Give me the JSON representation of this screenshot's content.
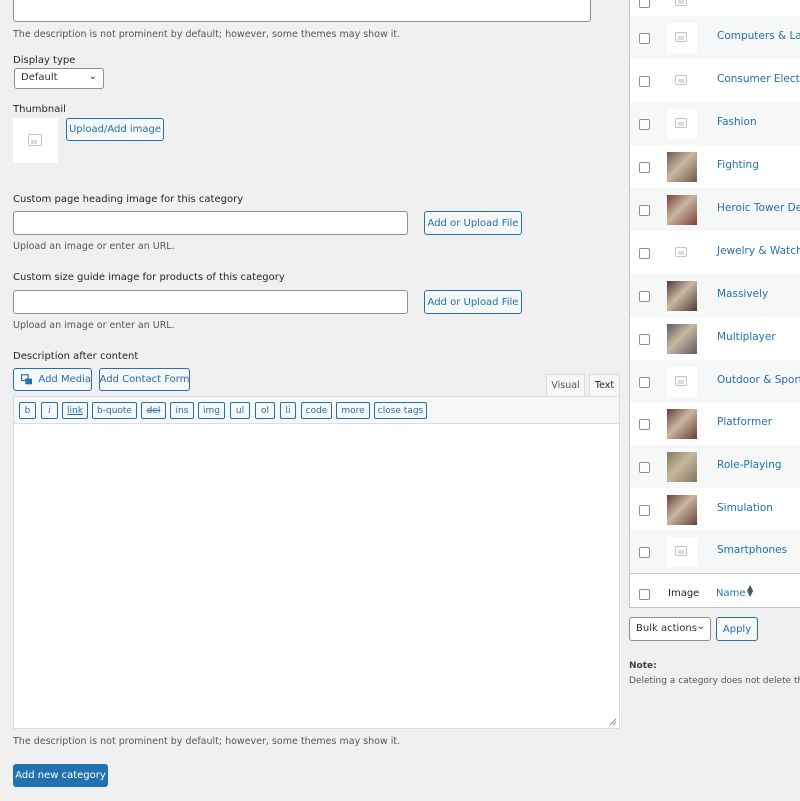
{
  "form": {
    "desc_help_top": "The description is not prominent by default; however, some themes may show it.",
    "display_type_label": "Display type",
    "display_type_value": "Default",
    "thumbnail_label": "Thumbnail",
    "upload_image_button": "Upload/Add image",
    "heading_image_label": "Custom page heading image for this category",
    "heading_image_value": "",
    "add_upload_file_button": "Add or Upload File",
    "upload_help": "Upload an image or enter an URL.",
    "size_guide_label": "Custom size guide image for products of this category",
    "size_guide_value": "",
    "desc_after_label": "Description after content",
    "add_media_button": "Add Media",
    "add_contact_form_button": "Add Contact Form",
    "tab_visual": "Visual",
    "tab_text": "Text",
    "quicktags": [
      "b",
      "i",
      "link",
      "b-quote",
      "del",
      "ins",
      "img",
      "ul",
      "ol",
      "li",
      "code",
      "more",
      "close tags"
    ],
    "desc_help_bottom": "The description is not prominent by default; however, some themes may show it.",
    "submit_button": "Add new category"
  },
  "list": {
    "rows": [
      {
        "name": "",
        "thumb": "placeholder"
      },
      {
        "name": "Computers & Lap",
        "thumb": "placeholder"
      },
      {
        "name": "Consumer Electro",
        "thumb": "placeholder"
      },
      {
        "name": "Fashion",
        "thumb": "placeholder"
      },
      {
        "name": "Fighting",
        "thumb": "image"
      },
      {
        "name": "Heroic Tower Defe",
        "thumb": "image"
      },
      {
        "name": "Jewelry & Watche",
        "thumb": "placeholder"
      },
      {
        "name": "Massively",
        "thumb": "image"
      },
      {
        "name": "Multiplayer",
        "thumb": "image"
      },
      {
        "name": "Outdoor & Sports",
        "thumb": "placeholder"
      },
      {
        "name": "Platformer",
        "thumb": "image"
      },
      {
        "name": "Role-Playing",
        "thumb": "image"
      },
      {
        "name": "Simulation",
        "thumb": "image"
      },
      {
        "name": "Smartphones",
        "thumb": "placeholder"
      }
    ],
    "footer_image": "Image",
    "footer_name": "Name",
    "bulk_actions": "Bulk actions",
    "apply_button": "Apply",
    "note_label": "Note:",
    "note_text": "Deleting a category does not delete the"
  },
  "colors": {
    "accent": "#2271b1",
    "background": "#f0f0f1"
  }
}
